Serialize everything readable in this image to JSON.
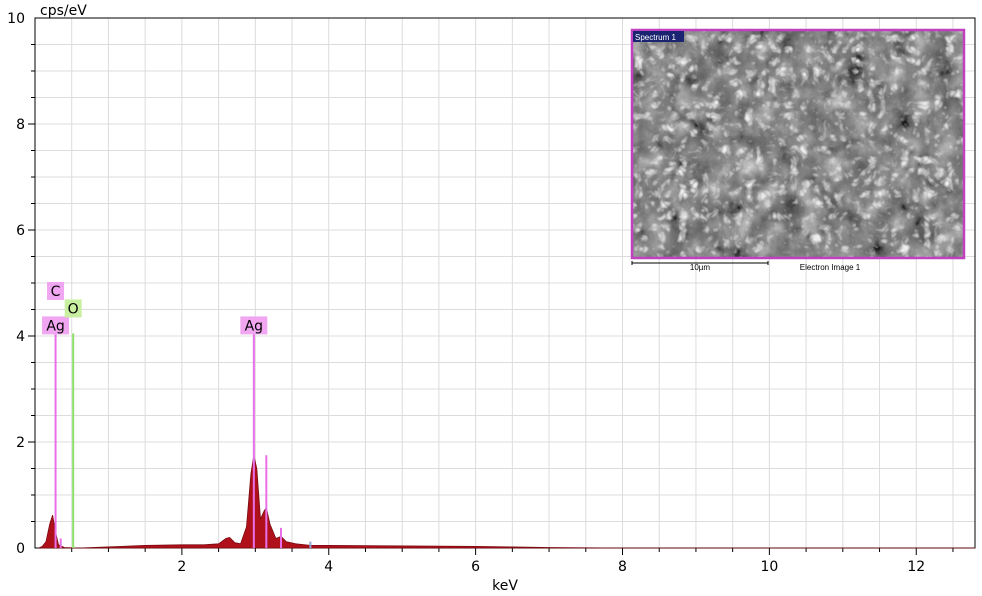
{
  "chart_data": {
    "type": "area",
    "xlabel": "keV",
    "ylabel": "cps/eV",
    "xlim": [
      0,
      12.8
    ],
    "ylim": [
      0,
      10
    ],
    "x_ticks": [
      2,
      4,
      6,
      8,
      10,
      12
    ],
    "y_ticks": [
      0,
      2,
      4,
      6,
      8,
      10
    ],
    "grid": true,
    "spectrum_color": "#b0101a",
    "series": [
      {
        "values": [
          {
            "x": 0.05,
            "y": 0
          },
          {
            "x": 0.1,
            "y": 0.03
          },
          {
            "x": 0.15,
            "y": 0.12
          },
          {
            "x": 0.2,
            "y": 0.45
          },
          {
            "x": 0.24,
            "y": 0.62
          },
          {
            "x": 0.28,
            "y": 0.3
          },
          {
            "x": 0.32,
            "y": 0.06
          },
          {
            "x": 0.4,
            "y": 0.01
          },
          {
            "x": 0.6,
            "y": 0.0
          },
          {
            "x": 1.0,
            "y": 0.02
          },
          {
            "x": 1.5,
            "y": 0.05
          },
          {
            "x": 2.0,
            "y": 0.06
          },
          {
            "x": 2.3,
            "y": 0.06
          },
          {
            "x": 2.5,
            "y": 0.08
          },
          {
            "x": 2.6,
            "y": 0.18
          },
          {
            "x": 2.65,
            "y": 0.2
          },
          {
            "x": 2.72,
            "y": 0.1
          },
          {
            "x": 2.8,
            "y": 0.08
          },
          {
            "x": 2.88,
            "y": 0.4
          },
          {
            "x": 2.94,
            "y": 1.4
          },
          {
            "x": 2.98,
            "y": 1.75
          },
          {
            "x": 3.02,
            "y": 1.5
          },
          {
            "x": 3.07,
            "y": 0.55
          },
          {
            "x": 3.12,
            "y": 0.7
          },
          {
            "x": 3.15,
            "y": 0.76
          },
          {
            "x": 3.2,
            "y": 0.45
          },
          {
            "x": 3.28,
            "y": 0.18
          },
          {
            "x": 3.35,
            "y": 0.22
          },
          {
            "x": 3.42,
            "y": 0.12
          },
          {
            "x": 3.55,
            "y": 0.08
          },
          {
            "x": 3.75,
            "y": 0.05
          },
          {
            "x": 4.0,
            "y": 0.05
          },
          {
            "x": 5.0,
            "y": 0.04
          },
          {
            "x": 6.0,
            "y": 0.03
          },
          {
            "x": 6.5,
            "y": 0.02
          },
          {
            "x": 7.0,
            "y": 0.01
          },
          {
            "x": 8.0,
            "y": 0.0
          },
          {
            "x": 12.8,
            "y": 0.0
          }
        ]
      }
    ],
    "markers": [
      {
        "x": 0.28,
        "y": 4.05,
        "color": "#e86fe8"
      },
      {
        "x": 0.52,
        "y": 4.05,
        "color": "#8ee068"
      },
      {
        "x": 2.98,
        "y": 4.05,
        "color": "#e86fe8"
      },
      {
        "x": 3.15,
        "y": 1.75,
        "color": "#e86fe8"
      },
      {
        "x": 0.35,
        "y": 0.18,
        "color": "#e86fe8"
      },
      {
        "x": 3.35,
        "y": 0.38,
        "color": "#e86fe8"
      },
      {
        "x": 3.75,
        "y": 0.12,
        "color": "#8fa4d6"
      }
    ],
    "labels": [
      {
        "text": "C",
        "x": 0.28,
        "y": 4.85,
        "color": "#f0a6f0"
      },
      {
        "text": "Ag",
        "x": 0.28,
        "y": 4.2,
        "color": "#f0a6f0"
      },
      {
        "text": "O",
        "x": 0.52,
        "y": 4.52,
        "color": "#c8f0a0"
      },
      {
        "text": "Ag",
        "x": 2.98,
        "y": 4.2,
        "color": "#f0a6f0"
      }
    ]
  },
  "inset": {
    "title": "Spectrum 1",
    "scale_bar": "10µm",
    "caption": "Electron Image 1",
    "frame_color": "#c040c0"
  }
}
